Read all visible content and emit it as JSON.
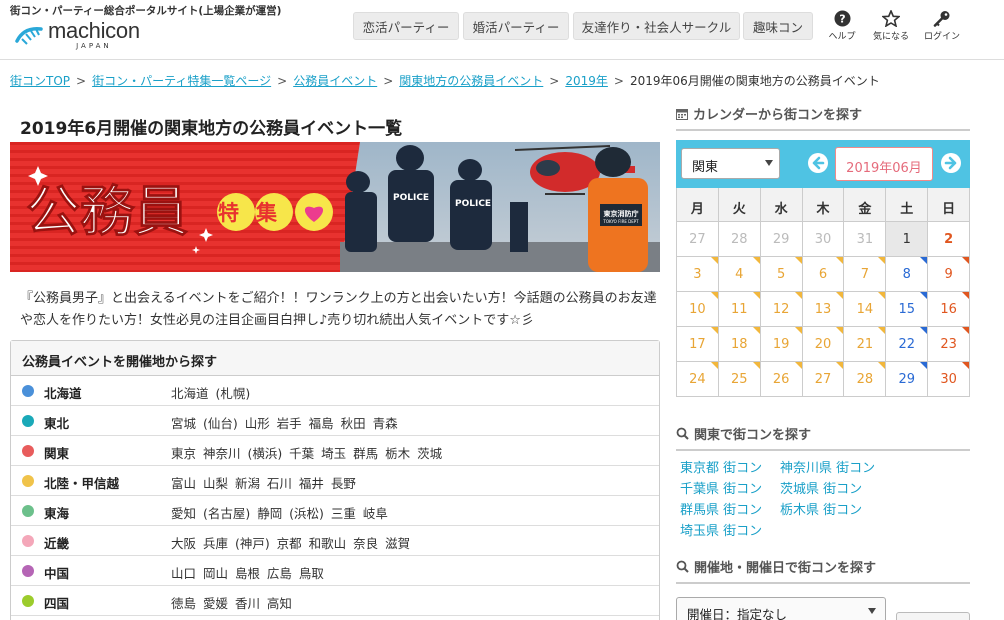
{
  "header": {
    "tagline": "街コン・パーティー総合ポータルサイト(上場企業が運営)",
    "logo_main": "machicon",
    "logo_sub": "JAPAN",
    "nav": [
      "恋活パーティー",
      "婚活パーティー",
      "友達作り・社会人サークル",
      "趣味コン"
    ],
    "icons": [
      {
        "label": "ヘルプ",
        "icon": "help-icon"
      },
      {
        "label": "気になる",
        "icon": "star-icon"
      },
      {
        "label": "ログイン",
        "icon": "key-icon"
      }
    ]
  },
  "breadcrumb": {
    "links": [
      "街コンTOP",
      "街コン・パーティ特集一覧ページ",
      "公務員イベント",
      "関東地方の公務員イベント",
      "2019年"
    ],
    "current": "2019年06月開催の関東地方の公務員イベント",
    "separator": ">"
  },
  "main": {
    "title": "2019年6月開催の関東地方の公務員イベント一覧",
    "banner": {
      "title": "公務員",
      "badge": "特集",
      "police_label": "POLICE",
      "fire_label": "東京消防庁",
      "fire_sub": "TOKYO FIRE DEPT"
    },
    "intro": "『公務員男子』と出会えるイベントをご紹介！！ワンランク上の方と出会いたい方！今話題の公務員のお友達や恋人を作りたい方！女性必見の注目企画目白押し♪売り切れ続出人気イベントです☆彡",
    "region_heading": "公務員イベントを開催地から探す",
    "regions": [
      {
        "name": "北海道",
        "color": "#4a90d9",
        "prefs": "北海道 (札幌)"
      },
      {
        "name": "東北",
        "color": "#1aa9b8",
        "prefs": "宮城 (仙台) 山形 岩手 福島 秋田 青森"
      },
      {
        "name": "関東",
        "color": "#e85c5c",
        "prefs": "東京 神奈川 (横浜) 千葉 埼玉 群馬 栃木 茨城"
      },
      {
        "name": "北陸・甲信越",
        "color": "#f0c34a",
        "prefs": "富山 山梨 新潟 石川 福井 長野"
      },
      {
        "name": "東海",
        "color": "#6cc08b",
        "prefs": "愛知 (名古屋) 静岡 (浜松) 三重 岐阜"
      },
      {
        "name": "近畿",
        "color": "#f4a7b9",
        "prefs": "大阪 兵庫 (神戸) 京都 和歌山 奈良 滋賀"
      },
      {
        "name": "中国",
        "color": "#b565b5",
        "prefs": "山口 岡山 島根 広島 鳥取"
      },
      {
        "name": "四国",
        "color": "#9ccc2c",
        "prefs": "徳島 愛媛 香川 高知"
      }
    ]
  },
  "sidebar": {
    "calendar_heading": "カレンダーから街コンを探す",
    "area_select": "関東",
    "month": "2019年06月",
    "dow": [
      "月",
      "火",
      "水",
      "木",
      "金",
      "土",
      "日"
    ],
    "weeks": [
      [
        {
          "d": "27",
          "t": "prev"
        },
        {
          "d": "28",
          "t": "prev"
        },
        {
          "d": "29",
          "t": "prev"
        },
        {
          "d": "30",
          "t": "prev"
        },
        {
          "d": "31",
          "t": "prev"
        },
        {
          "d": "1",
          "t": "today"
        },
        {
          "d": "2",
          "t": "sun",
          "f": "",
          "b": true
        }
      ],
      [
        {
          "d": "3",
          "t": "day",
          "f": "y"
        },
        {
          "d": "4",
          "t": "day",
          "f": "y"
        },
        {
          "d": "5",
          "t": "day",
          "f": "y"
        },
        {
          "d": "6",
          "t": "day",
          "f": "y"
        },
        {
          "d": "7",
          "t": "day",
          "f": "y"
        },
        {
          "d": "8",
          "t": "sat",
          "f": "b"
        },
        {
          "d": "9",
          "t": "sun",
          "f": "r"
        }
      ],
      [
        {
          "d": "10",
          "t": "day",
          "f": "y"
        },
        {
          "d": "11",
          "t": "day",
          "f": "y"
        },
        {
          "d": "12",
          "t": "day",
          "f": "y"
        },
        {
          "d": "13",
          "t": "day",
          "f": "y"
        },
        {
          "d": "14",
          "t": "day",
          "f": "y"
        },
        {
          "d": "15",
          "t": "sat",
          "f": "b"
        },
        {
          "d": "16",
          "t": "sun",
          "f": "r"
        }
      ],
      [
        {
          "d": "17",
          "t": "day",
          "f": "y"
        },
        {
          "d": "18",
          "t": "day",
          "f": "y"
        },
        {
          "d": "19",
          "t": "day",
          "f": "y"
        },
        {
          "d": "20",
          "t": "day",
          "f": "y"
        },
        {
          "d": "21",
          "t": "day",
          "f": "y"
        },
        {
          "d": "22",
          "t": "sat",
          "f": "b"
        },
        {
          "d": "23",
          "t": "sun",
          "f": "r"
        }
      ],
      [
        {
          "d": "24",
          "t": "day",
          "f": "y"
        },
        {
          "d": "25",
          "t": "day",
          "f": "y"
        },
        {
          "d": "26",
          "t": "day",
          "f": "y"
        },
        {
          "d": "27",
          "t": "day",
          "f": "y"
        },
        {
          "d": "28",
          "t": "day",
          "f": "y"
        },
        {
          "d": "29",
          "t": "sat",
          "f": "b"
        },
        {
          "d": "30",
          "t": "sun",
          "f": "r"
        }
      ]
    ],
    "pref_heading": "関東で街コンを探す",
    "pref_links": [
      "東京都 街コン",
      "神奈川県 街コン",
      "千葉県 街コン",
      "茨城県 街コン",
      "群馬県 街コン",
      "栃木県 街コン",
      "埼玉県 街コン"
    ],
    "search_heading": "開催地・開催日で街コンを探す",
    "date_select": "開催日：指定なし"
  }
}
